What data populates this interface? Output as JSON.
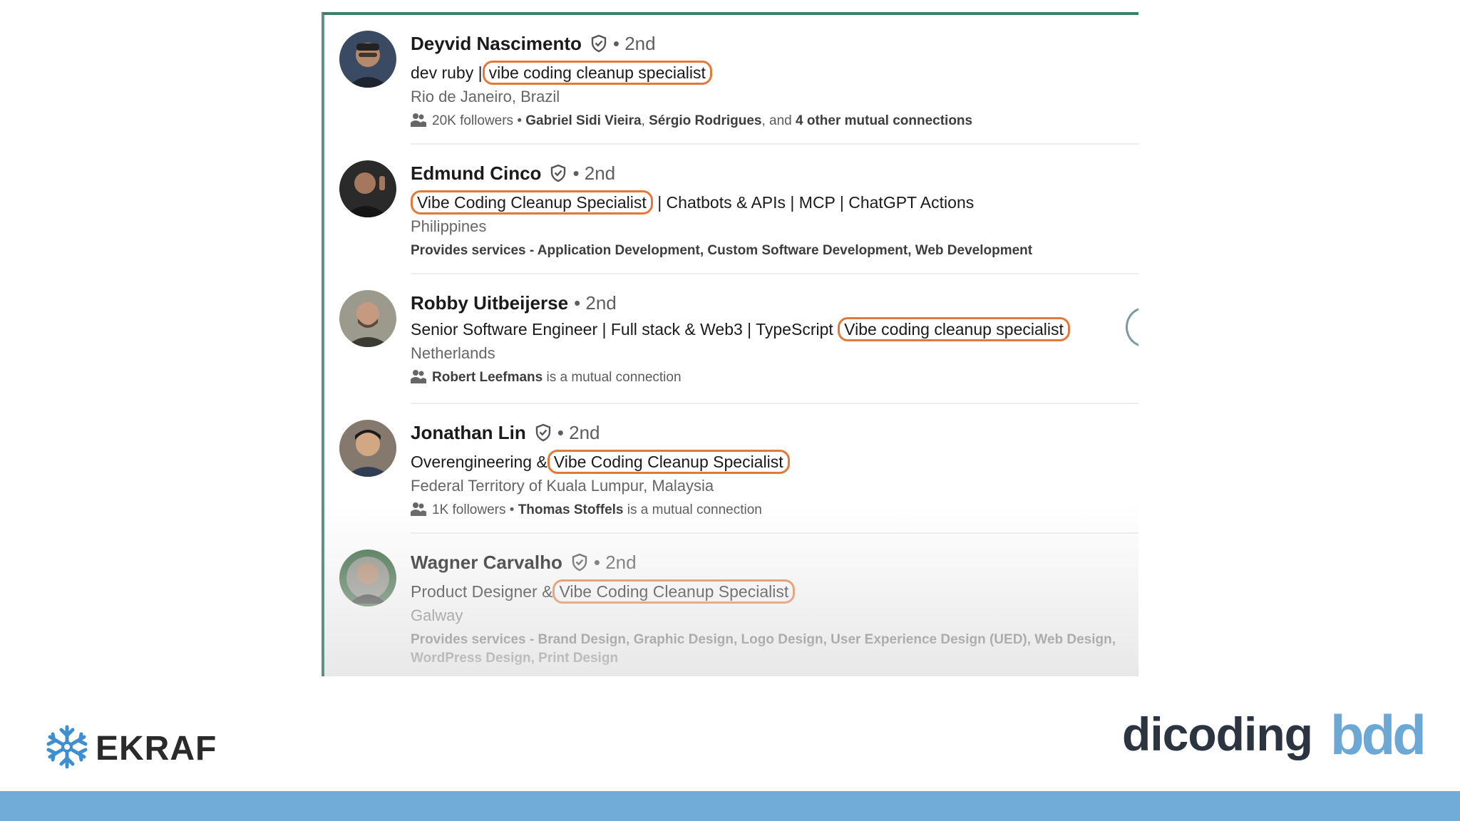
{
  "results": [
    {
      "name": "Deyvid Nascimento",
      "verified": true,
      "degree": "• 2nd",
      "headline_before": "dev ruby |",
      "headline_highlight": "vibe coding cleanup specialist",
      "headline_after": "",
      "location": "Rio de Janeiro, Brazil",
      "meta_icon": "people-icon",
      "meta_plain_1": "20K followers • ",
      "meta_bold_1": "Gabriel Sidi Vieira",
      "meta_plain_2": ", ",
      "meta_bold_2": "Sérgio Rodrigues",
      "meta_plain_3": ", and ",
      "meta_bold_3": "4 other mutual connections",
      "avatar_bg": "#3b4a63"
    },
    {
      "name": "Edmund Cinco",
      "verified": true,
      "degree": "• 2nd",
      "headline_before": "",
      "headline_highlight": "Vibe Coding Cleanup Specialist",
      "headline_after": "| Chatbots & APIs | MCP | ChatGPT Actions",
      "location": "Philippines",
      "meta_services": "Provides services - Application Development, Custom Software Development, Web Development",
      "avatar_bg": "#2a2a2a"
    },
    {
      "name": "Robby Uitbeijerse",
      "verified": false,
      "degree": "• 2nd",
      "headline_before": "Senior Software Engineer | Full stack & Web3 | TypeScript",
      "headline_highlight": "Vibe coding cleanup specialist",
      "headline_after": "",
      "location": "Netherlands",
      "meta_icon": "people-icon",
      "meta_bold_1": "Robert Leefmans",
      "meta_plain_2": " is a mutual connection",
      "avatar_bg": "#9c9a8c"
    },
    {
      "name": "Jonathan Lin",
      "verified": true,
      "degree": "• 2nd",
      "headline_before": "Overengineering &",
      "headline_highlight": "Vibe Coding Cleanup Specialist",
      "headline_after": "",
      "location": "Federal Territory of Kuala Lumpur, Malaysia",
      "meta_icon": "people-icon",
      "meta_plain_1": "1K followers • ",
      "meta_bold_1": "Thomas Stoffels",
      "meta_plain_2": " is a mutual connection",
      "avatar_bg": "#5a4a3c"
    },
    {
      "name": "Wagner Carvalho",
      "verified": true,
      "degree": "• 2nd",
      "headline_before": "Product Designer &",
      "headline_highlight": "Vibe Coding Cleanup Specialist",
      "headline_after": "",
      "location": "Galway",
      "meta_services": "Provides services - Brand Design, Graphic Design, Logo Design, User Experience Design (UED), Web Design, WordPress Design, Print Design",
      "avatar_bg": "#3d6b45"
    }
  ],
  "branding": {
    "ekraf": "EKRAF",
    "dicoding": "dicoding",
    "bdd": "bdd"
  },
  "colors": {
    "highlight_border": "#e07a3c",
    "footer_bar": "#71acd8",
    "frame_border": "#3d7d6a"
  }
}
